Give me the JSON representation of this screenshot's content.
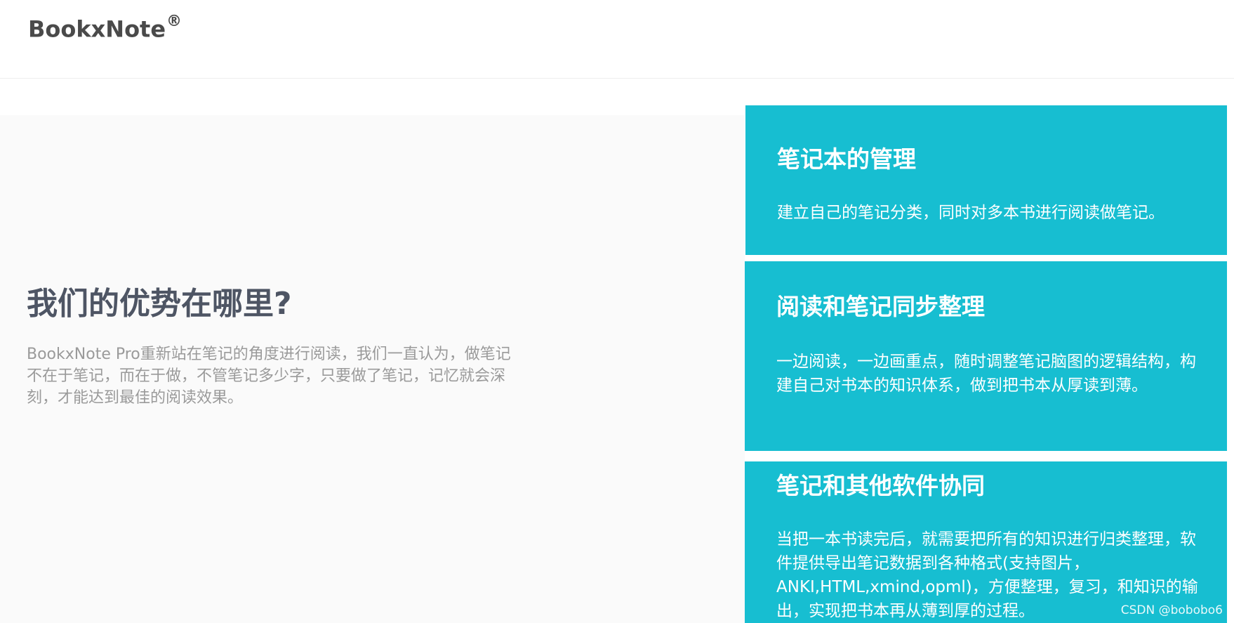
{
  "header": {
    "logo_text": "BookxNote",
    "logo_mark": "®"
  },
  "hero": {
    "title": "我们的优势在哪里?",
    "description": "BookxNote Pro重新站在笔记的角度进行阅读，我们一直认为，做笔记不在于笔记，而在于做，不管笔记多少字，只要做了笔记，记忆就会深刻，才能达到最佳的阅读效果。"
  },
  "features": [
    {
      "title": "笔记本的管理",
      "text": "建立自己的笔记分类，同时对多本书进行阅读做笔记。"
    },
    {
      "title": "阅读和笔记同步整理",
      "text": "一边阅读，一边画重点，随时调整笔记脑图的逻辑结构，构建自己对书本的知识体系，做到把书本从厚读到薄。"
    },
    {
      "title": "笔记和其他软件协同",
      "text": "当把一本书读完后，就需要把所有的知识进行归类整理，软件提供导出笔记数据到各种格式(支持图片，ANKI,HTML,xmind,opml)，方便整理，复习，和知识的输出，实现把书本再从薄到厚的过程。"
    }
  ],
  "watermark": "CSDN @bobobo6",
  "colors": {
    "accent": "#17bed1",
    "title_text": "#4e5564",
    "body_text": "#9a9a9a",
    "panel_bg": "#fafafa"
  }
}
